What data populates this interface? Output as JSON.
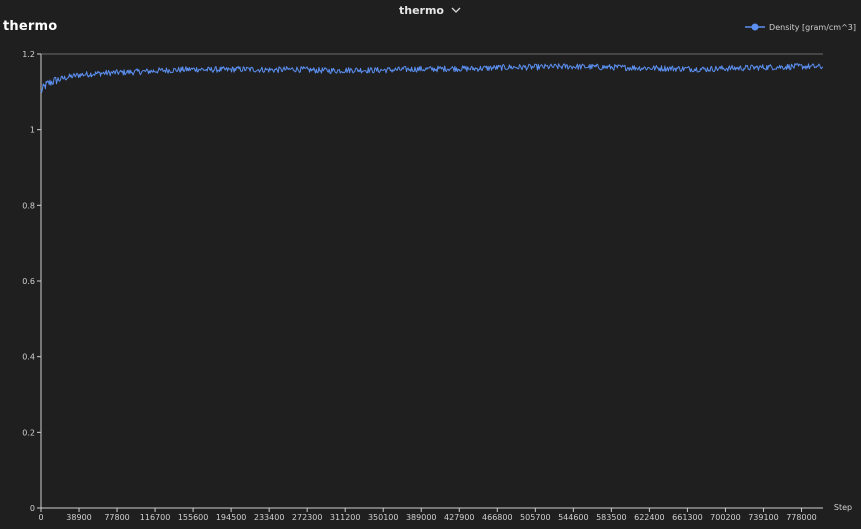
{
  "header": {
    "selector_label": "thermo",
    "panel_title": "thermo"
  },
  "icons": {
    "selector": "chevron-down-icon",
    "legend_marker": "circle-line-marker-icon"
  },
  "colors": {
    "background": "#1f1f1f",
    "series": "#5b8ff0",
    "axis": "#cfcfcf"
  },
  "chart_data": {
    "type": "line",
    "title": "thermo",
    "xlabel": "Step",
    "ylabel": "",
    "xlim": [
      0,
      800000
    ],
    "ylim": [
      0,
      1.2
    ],
    "x_ticks": [
      0,
      38900,
      77800,
      116700,
      155600,
      194500,
      233400,
      272300,
      311200,
      350100,
      389000,
      427900,
      466800,
      505700,
      544600,
      583500,
      622400,
      661300,
      700200,
      739100,
      778000
    ],
    "y_ticks": [
      0,
      0.2,
      0.4,
      0.6,
      0.8,
      1,
      1.2
    ],
    "grid": false,
    "legend_position": "top-right",
    "series": [
      {
        "name": "Density [gram/cm^3]",
        "color": "#5b8ff0",
        "x": [
          0,
          3000,
          6000,
          10000,
          15000,
          20000,
          30000,
          40000,
          50000,
          60000,
          70000,
          80000,
          90000,
          100000,
          110000,
          120000,
          130000,
          140000,
          150000,
          160000,
          170000,
          180000,
          190000,
          200000,
          220000,
          240000,
          260000,
          280000,
          300000,
          320000,
          340000,
          360000,
          380000,
          400000,
          420000,
          440000,
          460000,
          480000,
          500000,
          520000,
          540000,
          560000,
          580000,
          600000,
          620000,
          640000,
          660000,
          680000,
          700000,
          720000,
          740000,
          760000,
          780000,
          800000
        ],
        "values": [
          1.1,
          1.112,
          1.12,
          1.125,
          1.13,
          1.134,
          1.14,
          1.145,
          1.147,
          1.149,
          1.15,
          1.151,
          1.152,
          1.153,
          1.154,
          1.156,
          1.157,
          1.158,
          1.159,
          1.16,
          1.158,
          1.159,
          1.158,
          1.16,
          1.159,
          1.158,
          1.16,
          1.157,
          1.156,
          1.158,
          1.157,
          1.158,
          1.16,
          1.16,
          1.162,
          1.161,
          1.163,
          1.165,
          1.165,
          1.166,
          1.167,
          1.166,
          1.165,
          1.164,
          1.163,
          1.162,
          1.161,
          1.16,
          1.162,
          1.163,
          1.165,
          1.166,
          1.167,
          1.166
        ]
      }
    ]
  }
}
